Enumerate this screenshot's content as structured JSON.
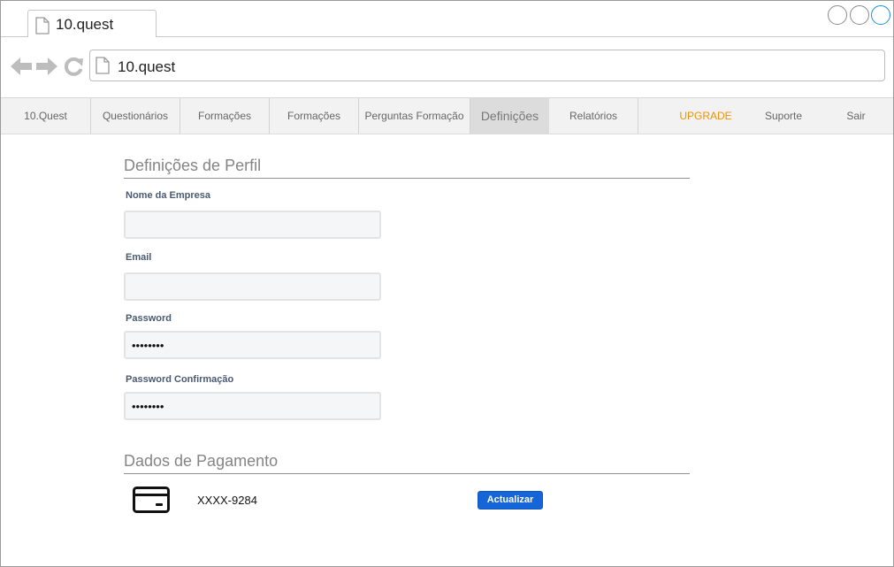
{
  "browser": {
    "tab_title": "10.quest",
    "url": "10.quest"
  },
  "nav": {
    "items": [
      {
        "label": "10.Quest"
      },
      {
        "label": "Questionários"
      },
      {
        "label": "Formações"
      },
      {
        "label": "Formações"
      },
      {
        "label": "Perguntas Formação"
      },
      {
        "label": "Definições",
        "active": true
      },
      {
        "label": "Relatórios"
      },
      {
        "label": "UPGRADE"
      },
      {
        "label": "Suporte"
      },
      {
        "label": "Sair"
      }
    ]
  },
  "profile": {
    "title": "Definições de Perfil",
    "company_label": "Nome da Empresa",
    "company_value": "",
    "email_label": "Email",
    "email_value": "",
    "password_label": "Password",
    "password_value": "••••••••",
    "password_confirm_label": "Password Confirmação",
    "password_confirm_value": "••••••••"
  },
  "payment": {
    "title": "Dados de Pagamento",
    "card_icon": "credit-card-icon",
    "card_number": "XXXX-9284",
    "update_label": "Actualizar"
  },
  "colors": {
    "accent": "#1665d8",
    "upgrade": "#f39200"
  }
}
